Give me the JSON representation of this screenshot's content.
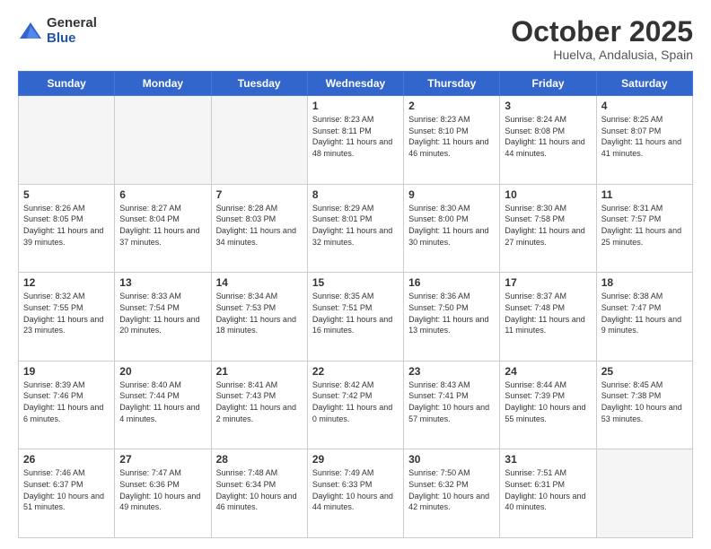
{
  "logo": {
    "general": "General",
    "blue": "Blue"
  },
  "title": {
    "month_year": "October 2025",
    "location": "Huelva, Andalusia, Spain"
  },
  "weekdays": [
    "Sunday",
    "Monday",
    "Tuesday",
    "Wednesday",
    "Thursday",
    "Friday",
    "Saturday"
  ],
  "weeks": [
    [
      {
        "day": "",
        "info": ""
      },
      {
        "day": "",
        "info": ""
      },
      {
        "day": "",
        "info": ""
      },
      {
        "day": "1",
        "info": "Sunrise: 8:23 AM\nSunset: 8:11 PM\nDaylight: 11 hours\nand 48 minutes."
      },
      {
        "day": "2",
        "info": "Sunrise: 8:23 AM\nSunset: 8:10 PM\nDaylight: 11 hours\nand 46 minutes."
      },
      {
        "day": "3",
        "info": "Sunrise: 8:24 AM\nSunset: 8:08 PM\nDaylight: 11 hours\nand 44 minutes."
      },
      {
        "day": "4",
        "info": "Sunrise: 8:25 AM\nSunset: 8:07 PM\nDaylight: 11 hours\nand 41 minutes."
      }
    ],
    [
      {
        "day": "5",
        "info": "Sunrise: 8:26 AM\nSunset: 8:05 PM\nDaylight: 11 hours\nand 39 minutes."
      },
      {
        "day": "6",
        "info": "Sunrise: 8:27 AM\nSunset: 8:04 PM\nDaylight: 11 hours\nand 37 minutes."
      },
      {
        "day": "7",
        "info": "Sunrise: 8:28 AM\nSunset: 8:03 PM\nDaylight: 11 hours\nand 34 minutes."
      },
      {
        "day": "8",
        "info": "Sunrise: 8:29 AM\nSunset: 8:01 PM\nDaylight: 11 hours\nand 32 minutes."
      },
      {
        "day": "9",
        "info": "Sunrise: 8:30 AM\nSunset: 8:00 PM\nDaylight: 11 hours\nand 30 minutes."
      },
      {
        "day": "10",
        "info": "Sunrise: 8:30 AM\nSunset: 7:58 PM\nDaylight: 11 hours\nand 27 minutes."
      },
      {
        "day": "11",
        "info": "Sunrise: 8:31 AM\nSunset: 7:57 PM\nDaylight: 11 hours\nand 25 minutes."
      }
    ],
    [
      {
        "day": "12",
        "info": "Sunrise: 8:32 AM\nSunset: 7:55 PM\nDaylight: 11 hours\nand 23 minutes."
      },
      {
        "day": "13",
        "info": "Sunrise: 8:33 AM\nSunset: 7:54 PM\nDaylight: 11 hours\nand 20 minutes."
      },
      {
        "day": "14",
        "info": "Sunrise: 8:34 AM\nSunset: 7:53 PM\nDaylight: 11 hours\nand 18 minutes."
      },
      {
        "day": "15",
        "info": "Sunrise: 8:35 AM\nSunset: 7:51 PM\nDaylight: 11 hours\nand 16 minutes."
      },
      {
        "day": "16",
        "info": "Sunrise: 8:36 AM\nSunset: 7:50 PM\nDaylight: 11 hours\nand 13 minutes."
      },
      {
        "day": "17",
        "info": "Sunrise: 8:37 AM\nSunset: 7:48 PM\nDaylight: 11 hours\nand 11 minutes."
      },
      {
        "day": "18",
        "info": "Sunrise: 8:38 AM\nSunset: 7:47 PM\nDaylight: 11 hours\nand 9 minutes."
      }
    ],
    [
      {
        "day": "19",
        "info": "Sunrise: 8:39 AM\nSunset: 7:46 PM\nDaylight: 11 hours\nand 6 minutes."
      },
      {
        "day": "20",
        "info": "Sunrise: 8:40 AM\nSunset: 7:44 PM\nDaylight: 11 hours\nand 4 minutes."
      },
      {
        "day": "21",
        "info": "Sunrise: 8:41 AM\nSunset: 7:43 PM\nDaylight: 11 hours\nand 2 minutes."
      },
      {
        "day": "22",
        "info": "Sunrise: 8:42 AM\nSunset: 7:42 PM\nDaylight: 11 hours\nand 0 minutes."
      },
      {
        "day": "23",
        "info": "Sunrise: 8:43 AM\nSunset: 7:41 PM\nDaylight: 10 hours\nand 57 minutes."
      },
      {
        "day": "24",
        "info": "Sunrise: 8:44 AM\nSunset: 7:39 PM\nDaylight: 10 hours\nand 55 minutes."
      },
      {
        "day": "25",
        "info": "Sunrise: 8:45 AM\nSunset: 7:38 PM\nDaylight: 10 hours\nand 53 minutes."
      }
    ],
    [
      {
        "day": "26",
        "info": "Sunrise: 7:46 AM\nSunset: 6:37 PM\nDaylight: 10 hours\nand 51 minutes."
      },
      {
        "day": "27",
        "info": "Sunrise: 7:47 AM\nSunset: 6:36 PM\nDaylight: 10 hours\nand 49 minutes."
      },
      {
        "day": "28",
        "info": "Sunrise: 7:48 AM\nSunset: 6:34 PM\nDaylight: 10 hours\nand 46 minutes."
      },
      {
        "day": "29",
        "info": "Sunrise: 7:49 AM\nSunset: 6:33 PM\nDaylight: 10 hours\nand 44 minutes."
      },
      {
        "day": "30",
        "info": "Sunrise: 7:50 AM\nSunset: 6:32 PM\nDaylight: 10 hours\nand 42 minutes."
      },
      {
        "day": "31",
        "info": "Sunrise: 7:51 AM\nSunset: 6:31 PM\nDaylight: 10 hours\nand 40 minutes."
      },
      {
        "day": "",
        "info": ""
      }
    ]
  ]
}
